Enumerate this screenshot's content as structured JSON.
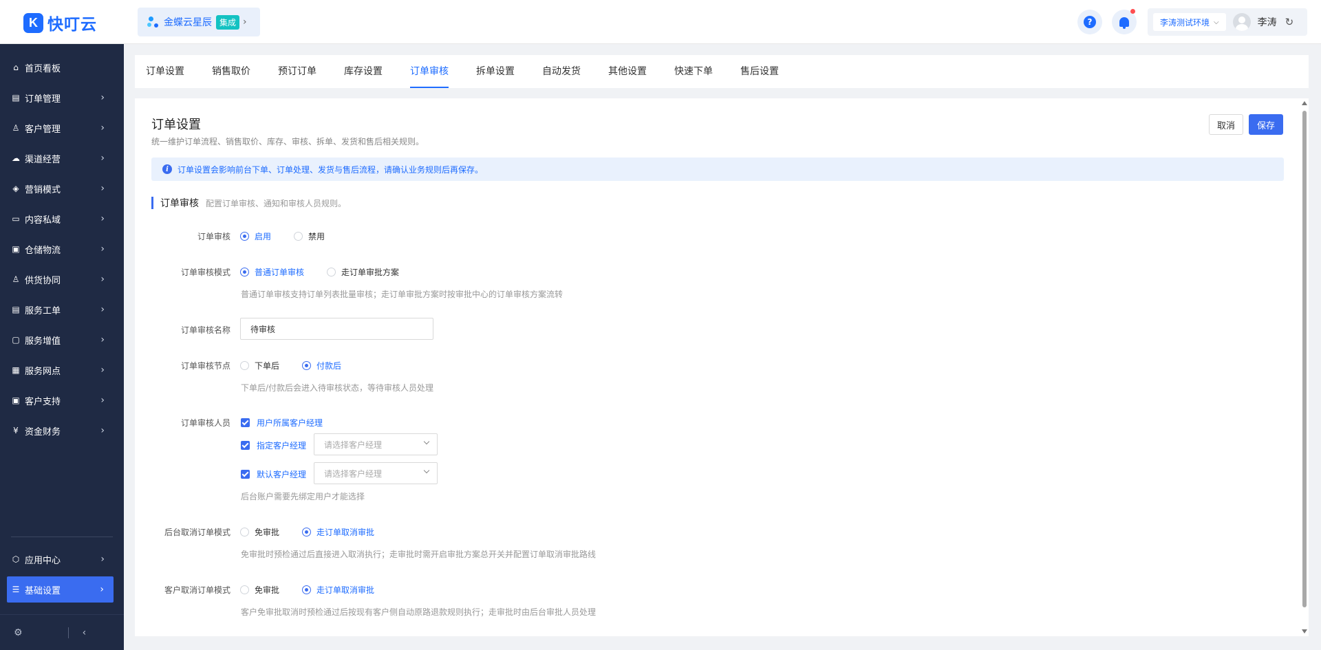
{
  "header": {
    "logo_mark": "K",
    "logo_text": "快叮云",
    "product": {
      "name": "金蝶云星辰",
      "tag": "集成"
    },
    "help_label": "?",
    "environment": "李涛测试环境",
    "user_name": "李涛"
  },
  "sidebar": {
    "items": [
      {
        "label": "首页看板",
        "icon": "home-icon",
        "glyph": "⌂"
      },
      {
        "label": "订单管理",
        "icon": "order-icon",
        "glyph": "▤"
      },
      {
        "label": "客户管理",
        "icon": "user-icon",
        "glyph": "♙"
      },
      {
        "label": "渠道经营",
        "icon": "channel-icon",
        "glyph": "☁"
      },
      {
        "label": "营销模式",
        "icon": "tag-icon",
        "glyph": "◈"
      },
      {
        "label": "内容私域",
        "icon": "image-icon",
        "glyph": "▭"
      },
      {
        "label": "仓储物流",
        "icon": "box-icon",
        "glyph": "▣"
      },
      {
        "label": "供货协同",
        "icon": "supplier-icon",
        "glyph": "♙"
      },
      {
        "label": "服务工单",
        "icon": "ticket-icon",
        "glyph": "▤"
      },
      {
        "label": "服务增值",
        "icon": "bag-icon",
        "glyph": "▢"
      },
      {
        "label": "服务网点",
        "icon": "store-icon",
        "glyph": "▦"
      },
      {
        "label": "客户支持",
        "icon": "support-icon",
        "glyph": "▣"
      },
      {
        "label": "资金财务",
        "icon": "yuan-icon",
        "glyph": "¥"
      }
    ],
    "bottom_items": [
      {
        "label": "应用中心",
        "icon": "app-center-icon",
        "glyph": "⬡"
      },
      {
        "label": "基础设置",
        "icon": "settings-list-icon",
        "glyph": "☰"
      }
    ]
  },
  "tabs": [
    "订单设置",
    "销售取价",
    "预订订单",
    "库存设置",
    "订单审核",
    "拆单设置",
    "自动发货",
    "其他设置",
    "快速下单",
    "售后设置"
  ],
  "active_tab_index": 4,
  "page": {
    "title": "订单设置",
    "description": "统一维护订单流程、销售取价、库存、审核、拆单、发货和售后相关规则。",
    "cancel_label": "取消",
    "save_label": "保存",
    "alert": "订单设置会影响前台下单、订单处理、发货与售后流程，请确认业务规则后再保存。"
  },
  "section": {
    "title": "订单审核",
    "description": "配置订单审核、通知和审核人员规则。"
  },
  "form": {
    "audit": {
      "label": "订单审核",
      "options": [
        "启用",
        "禁用"
      ],
      "selected": 0
    },
    "audit_mode": {
      "label": "订单审核模式",
      "options": [
        "普通订单审核",
        "走订单审批方案"
      ],
      "selected": 0,
      "hint": "普通订单审核支持订单列表批量审核；走订单审批方案时按审批中心的订单审核方案流转"
    },
    "audit_name": {
      "label": "订单审核名称",
      "value": "待审核"
    },
    "audit_node": {
      "label": "订单审核节点",
      "options": [
        "下单后",
        "付款后"
      ],
      "selected": 1,
      "hint": "下单后/付款后会进入待审核状态，等待审核人员处理"
    },
    "auditors": {
      "label": "订单审核人员",
      "checks": [
        "用户所属客户经理",
        "指定客户经理",
        "默认客户经理"
      ],
      "select_placeholder": "请选择客户经理",
      "hint": "后台账户需要先绑定用户才能选择"
    },
    "backend_cancel": {
      "label": "后台取消订单模式",
      "options": [
        "免审批",
        "走订单取消审批"
      ],
      "selected": 1,
      "hint": "免审批时预检通过后直接进入取消执行；走审批时需开启审批方案总开关并配置订单取消审批路线"
    },
    "customer_cancel": {
      "label": "客户取消订单模式",
      "options": [
        "免审批",
        "走订单取消审批"
      ],
      "selected": 1,
      "hint": "客户免审批取消时预检通过后按现有客户侧自动原路退款规则执行；走审批时由后台审批人员处理"
    }
  },
  "colors": {
    "accent": "#3a6cf0",
    "sidebar_bg": "#1f2a44",
    "alert_bg": "#e9f1fd"
  }
}
